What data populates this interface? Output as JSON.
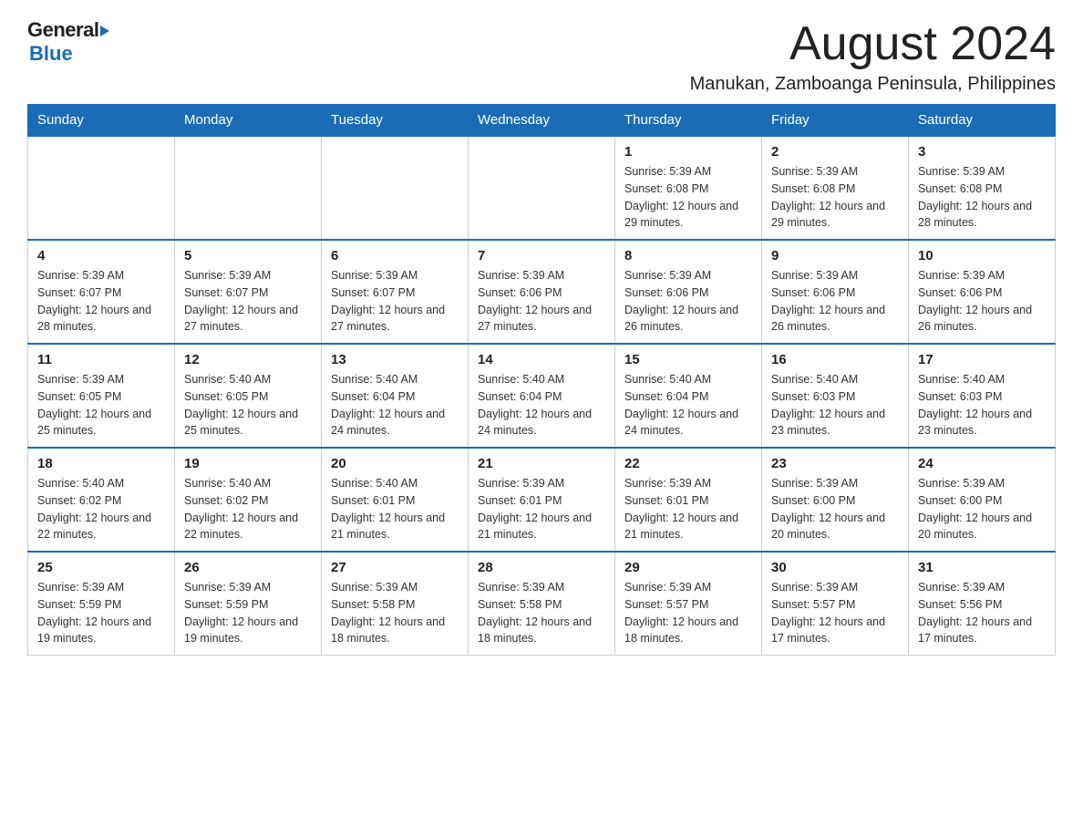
{
  "logo": {
    "general": "General",
    "arrow": "▶",
    "blue": "Blue"
  },
  "header": {
    "month": "August 2024",
    "location": "Manukan, Zamboanga Peninsula, Philippines"
  },
  "days": {
    "headers": [
      "Sunday",
      "Monday",
      "Tuesday",
      "Wednesday",
      "Thursday",
      "Friday",
      "Saturday"
    ]
  },
  "weeks": [
    {
      "days": [
        {
          "number": "",
          "info": ""
        },
        {
          "number": "",
          "info": ""
        },
        {
          "number": "",
          "info": ""
        },
        {
          "number": "",
          "info": ""
        },
        {
          "number": "1",
          "info": "Sunrise: 5:39 AM\nSunset: 6:08 PM\nDaylight: 12 hours and 29 minutes."
        },
        {
          "number": "2",
          "info": "Sunrise: 5:39 AM\nSunset: 6:08 PM\nDaylight: 12 hours and 29 minutes."
        },
        {
          "number": "3",
          "info": "Sunrise: 5:39 AM\nSunset: 6:08 PM\nDaylight: 12 hours and 28 minutes."
        }
      ]
    },
    {
      "days": [
        {
          "number": "4",
          "info": "Sunrise: 5:39 AM\nSunset: 6:07 PM\nDaylight: 12 hours and 28 minutes."
        },
        {
          "number": "5",
          "info": "Sunrise: 5:39 AM\nSunset: 6:07 PM\nDaylight: 12 hours and 27 minutes."
        },
        {
          "number": "6",
          "info": "Sunrise: 5:39 AM\nSunset: 6:07 PM\nDaylight: 12 hours and 27 minutes."
        },
        {
          "number": "7",
          "info": "Sunrise: 5:39 AM\nSunset: 6:06 PM\nDaylight: 12 hours and 27 minutes."
        },
        {
          "number": "8",
          "info": "Sunrise: 5:39 AM\nSunset: 6:06 PM\nDaylight: 12 hours and 26 minutes."
        },
        {
          "number": "9",
          "info": "Sunrise: 5:39 AM\nSunset: 6:06 PM\nDaylight: 12 hours and 26 minutes."
        },
        {
          "number": "10",
          "info": "Sunrise: 5:39 AM\nSunset: 6:06 PM\nDaylight: 12 hours and 26 minutes."
        }
      ]
    },
    {
      "days": [
        {
          "number": "11",
          "info": "Sunrise: 5:39 AM\nSunset: 6:05 PM\nDaylight: 12 hours and 25 minutes."
        },
        {
          "number": "12",
          "info": "Sunrise: 5:40 AM\nSunset: 6:05 PM\nDaylight: 12 hours and 25 minutes."
        },
        {
          "number": "13",
          "info": "Sunrise: 5:40 AM\nSunset: 6:04 PM\nDaylight: 12 hours and 24 minutes."
        },
        {
          "number": "14",
          "info": "Sunrise: 5:40 AM\nSunset: 6:04 PM\nDaylight: 12 hours and 24 minutes."
        },
        {
          "number": "15",
          "info": "Sunrise: 5:40 AM\nSunset: 6:04 PM\nDaylight: 12 hours and 24 minutes."
        },
        {
          "number": "16",
          "info": "Sunrise: 5:40 AM\nSunset: 6:03 PM\nDaylight: 12 hours and 23 minutes."
        },
        {
          "number": "17",
          "info": "Sunrise: 5:40 AM\nSunset: 6:03 PM\nDaylight: 12 hours and 23 minutes."
        }
      ]
    },
    {
      "days": [
        {
          "number": "18",
          "info": "Sunrise: 5:40 AM\nSunset: 6:02 PM\nDaylight: 12 hours and 22 minutes."
        },
        {
          "number": "19",
          "info": "Sunrise: 5:40 AM\nSunset: 6:02 PM\nDaylight: 12 hours and 22 minutes."
        },
        {
          "number": "20",
          "info": "Sunrise: 5:40 AM\nSunset: 6:01 PM\nDaylight: 12 hours and 21 minutes."
        },
        {
          "number": "21",
          "info": "Sunrise: 5:39 AM\nSunset: 6:01 PM\nDaylight: 12 hours and 21 minutes."
        },
        {
          "number": "22",
          "info": "Sunrise: 5:39 AM\nSunset: 6:01 PM\nDaylight: 12 hours and 21 minutes."
        },
        {
          "number": "23",
          "info": "Sunrise: 5:39 AM\nSunset: 6:00 PM\nDaylight: 12 hours and 20 minutes."
        },
        {
          "number": "24",
          "info": "Sunrise: 5:39 AM\nSunset: 6:00 PM\nDaylight: 12 hours and 20 minutes."
        }
      ]
    },
    {
      "days": [
        {
          "number": "25",
          "info": "Sunrise: 5:39 AM\nSunset: 5:59 PM\nDaylight: 12 hours and 19 minutes."
        },
        {
          "number": "26",
          "info": "Sunrise: 5:39 AM\nSunset: 5:59 PM\nDaylight: 12 hours and 19 minutes."
        },
        {
          "number": "27",
          "info": "Sunrise: 5:39 AM\nSunset: 5:58 PM\nDaylight: 12 hours and 18 minutes."
        },
        {
          "number": "28",
          "info": "Sunrise: 5:39 AM\nSunset: 5:58 PM\nDaylight: 12 hours and 18 minutes."
        },
        {
          "number": "29",
          "info": "Sunrise: 5:39 AM\nSunset: 5:57 PM\nDaylight: 12 hours and 18 minutes."
        },
        {
          "number": "30",
          "info": "Sunrise: 5:39 AM\nSunset: 5:57 PM\nDaylight: 12 hours and 17 minutes."
        },
        {
          "number": "31",
          "info": "Sunrise: 5:39 AM\nSunset: 5:56 PM\nDaylight: 12 hours and 17 minutes."
        }
      ]
    }
  ]
}
